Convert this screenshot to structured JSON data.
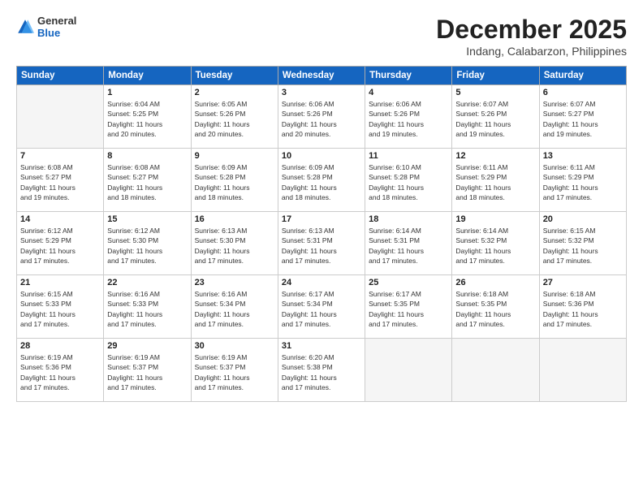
{
  "header": {
    "logo_general": "General",
    "logo_blue": "Blue",
    "title": "December 2025",
    "subtitle": "Indang, Calabarzon, Philippines"
  },
  "weekdays": [
    "Sunday",
    "Monday",
    "Tuesday",
    "Wednesday",
    "Thursday",
    "Friday",
    "Saturday"
  ],
  "weeks": [
    [
      {
        "day": "",
        "info": ""
      },
      {
        "day": "1",
        "info": "Sunrise: 6:04 AM\nSunset: 5:25 PM\nDaylight: 11 hours\nand 20 minutes."
      },
      {
        "day": "2",
        "info": "Sunrise: 6:05 AM\nSunset: 5:26 PM\nDaylight: 11 hours\nand 20 minutes."
      },
      {
        "day": "3",
        "info": "Sunrise: 6:06 AM\nSunset: 5:26 PM\nDaylight: 11 hours\nand 20 minutes."
      },
      {
        "day": "4",
        "info": "Sunrise: 6:06 AM\nSunset: 5:26 PM\nDaylight: 11 hours\nand 19 minutes."
      },
      {
        "day": "5",
        "info": "Sunrise: 6:07 AM\nSunset: 5:26 PM\nDaylight: 11 hours\nand 19 minutes."
      },
      {
        "day": "6",
        "info": "Sunrise: 6:07 AM\nSunset: 5:27 PM\nDaylight: 11 hours\nand 19 minutes."
      }
    ],
    [
      {
        "day": "7",
        "info": "Sunrise: 6:08 AM\nSunset: 5:27 PM\nDaylight: 11 hours\nand 19 minutes."
      },
      {
        "day": "8",
        "info": "Sunrise: 6:08 AM\nSunset: 5:27 PM\nDaylight: 11 hours\nand 18 minutes."
      },
      {
        "day": "9",
        "info": "Sunrise: 6:09 AM\nSunset: 5:28 PM\nDaylight: 11 hours\nand 18 minutes."
      },
      {
        "day": "10",
        "info": "Sunrise: 6:09 AM\nSunset: 5:28 PM\nDaylight: 11 hours\nand 18 minutes."
      },
      {
        "day": "11",
        "info": "Sunrise: 6:10 AM\nSunset: 5:28 PM\nDaylight: 11 hours\nand 18 minutes."
      },
      {
        "day": "12",
        "info": "Sunrise: 6:11 AM\nSunset: 5:29 PM\nDaylight: 11 hours\nand 18 minutes."
      },
      {
        "day": "13",
        "info": "Sunrise: 6:11 AM\nSunset: 5:29 PM\nDaylight: 11 hours\nand 17 minutes."
      }
    ],
    [
      {
        "day": "14",
        "info": "Sunrise: 6:12 AM\nSunset: 5:29 PM\nDaylight: 11 hours\nand 17 minutes."
      },
      {
        "day": "15",
        "info": "Sunrise: 6:12 AM\nSunset: 5:30 PM\nDaylight: 11 hours\nand 17 minutes."
      },
      {
        "day": "16",
        "info": "Sunrise: 6:13 AM\nSunset: 5:30 PM\nDaylight: 11 hours\nand 17 minutes."
      },
      {
        "day": "17",
        "info": "Sunrise: 6:13 AM\nSunset: 5:31 PM\nDaylight: 11 hours\nand 17 minutes."
      },
      {
        "day": "18",
        "info": "Sunrise: 6:14 AM\nSunset: 5:31 PM\nDaylight: 11 hours\nand 17 minutes."
      },
      {
        "day": "19",
        "info": "Sunrise: 6:14 AM\nSunset: 5:32 PM\nDaylight: 11 hours\nand 17 minutes."
      },
      {
        "day": "20",
        "info": "Sunrise: 6:15 AM\nSunset: 5:32 PM\nDaylight: 11 hours\nand 17 minutes."
      }
    ],
    [
      {
        "day": "21",
        "info": "Sunrise: 6:15 AM\nSunset: 5:33 PM\nDaylight: 11 hours\nand 17 minutes."
      },
      {
        "day": "22",
        "info": "Sunrise: 6:16 AM\nSunset: 5:33 PM\nDaylight: 11 hours\nand 17 minutes."
      },
      {
        "day": "23",
        "info": "Sunrise: 6:16 AM\nSunset: 5:34 PM\nDaylight: 11 hours\nand 17 minutes."
      },
      {
        "day": "24",
        "info": "Sunrise: 6:17 AM\nSunset: 5:34 PM\nDaylight: 11 hours\nand 17 minutes."
      },
      {
        "day": "25",
        "info": "Sunrise: 6:17 AM\nSunset: 5:35 PM\nDaylight: 11 hours\nand 17 minutes."
      },
      {
        "day": "26",
        "info": "Sunrise: 6:18 AM\nSunset: 5:35 PM\nDaylight: 11 hours\nand 17 minutes."
      },
      {
        "day": "27",
        "info": "Sunrise: 6:18 AM\nSunset: 5:36 PM\nDaylight: 11 hours\nand 17 minutes."
      }
    ],
    [
      {
        "day": "28",
        "info": "Sunrise: 6:19 AM\nSunset: 5:36 PM\nDaylight: 11 hours\nand 17 minutes."
      },
      {
        "day": "29",
        "info": "Sunrise: 6:19 AM\nSunset: 5:37 PM\nDaylight: 11 hours\nand 17 minutes."
      },
      {
        "day": "30",
        "info": "Sunrise: 6:19 AM\nSunset: 5:37 PM\nDaylight: 11 hours\nand 17 minutes."
      },
      {
        "day": "31",
        "info": "Sunrise: 6:20 AM\nSunset: 5:38 PM\nDaylight: 11 hours\nand 17 minutes."
      },
      {
        "day": "",
        "info": ""
      },
      {
        "day": "",
        "info": ""
      },
      {
        "day": "",
        "info": ""
      }
    ]
  ]
}
